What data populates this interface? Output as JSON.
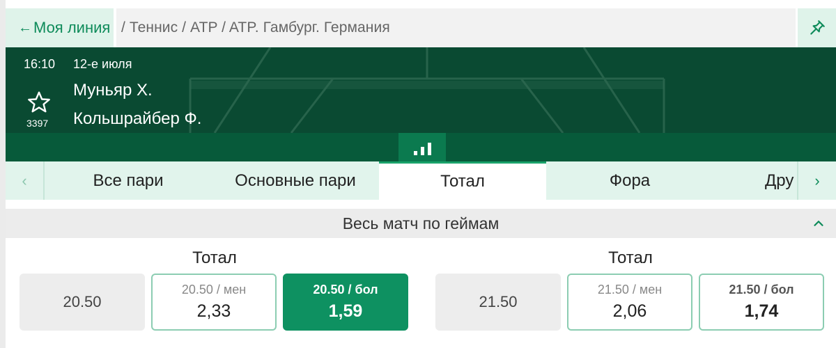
{
  "breadcrumb": {
    "back_label": "Моя линия",
    "path": "/ Теннис / ATP / ATP. Гамбург. Германия"
  },
  "event": {
    "time": "16:10",
    "date": "12-е июля",
    "player1": "Муньяр Х.",
    "player2": "Кольшрайбер Ф.",
    "favorites_count": "3397"
  },
  "tabs": {
    "items": [
      {
        "label": "Все пари"
      },
      {
        "label": "Основные пари"
      },
      {
        "label": "Тотал"
      },
      {
        "label": "Фора"
      },
      {
        "label": "Дру"
      }
    ],
    "active": "Тотал"
  },
  "section": {
    "title": "Весь матч по геймам"
  },
  "markets": [
    {
      "title": "Тотал",
      "line": "20.50",
      "under": {
        "label": "20.50 / мен",
        "odds": "2,33"
      },
      "over": {
        "label": "20.50 / бол",
        "odds": "1,59",
        "selected": true
      }
    },
    {
      "title": "Тотал",
      "line": "21.50",
      "under": {
        "label": "21.50 / мен",
        "odds": "2,06"
      },
      "over": {
        "label": "21.50 / бол",
        "odds": "1,74",
        "selected": false
      }
    }
  ],
  "colors": {
    "accent": "#0e9161",
    "header_bg": "#0a4a32",
    "tab_bg": "#e1f4ec",
    "back_bg": "#dff3ea"
  },
  "icons": [
    "arrow-left-icon",
    "pin-icon",
    "star-icon",
    "stats-bars-icon",
    "chevron-left-icon",
    "chevron-right-icon",
    "chevron-up-icon"
  ]
}
